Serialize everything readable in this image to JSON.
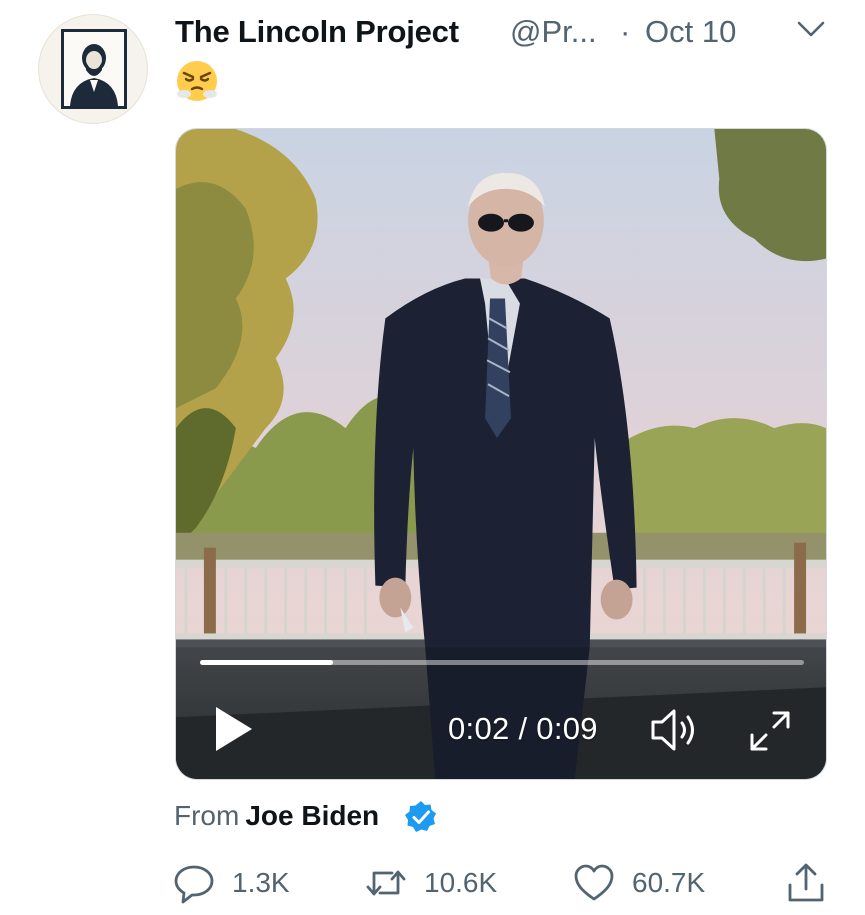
{
  "tweet": {
    "display_name": "The Lincoln Project",
    "handle": "@Pr...",
    "separator": "·",
    "date": "Oct 10",
    "emoji": "😤",
    "avatar_icon": "lincoln-portrait-icon",
    "menu_icon": "chevron-down-icon"
  },
  "video": {
    "time": "0:02 / 0:09",
    "progress": 0.22,
    "controls": {
      "play_icon": "play-icon",
      "volume_icon": "volume-icon",
      "fullscreen_icon": "fullscreen-icon"
    }
  },
  "attribution": {
    "prefix": "From",
    "name": "Joe Biden",
    "badge_icon": "verified-badge-icon",
    "badge_color": "#1d9bf0"
  },
  "actions": {
    "reply": {
      "count": "1.3K",
      "icon": "reply-icon"
    },
    "retweet": {
      "count": "10.6K",
      "icon": "retweet-icon"
    },
    "like": {
      "count": "60.7K",
      "icon": "heart-icon"
    },
    "share": {
      "icon": "share-icon"
    }
  },
  "colors": {
    "text_primary": "#0f1419",
    "text_secondary": "#536471",
    "verified_blue": "#1d9bf0"
  }
}
